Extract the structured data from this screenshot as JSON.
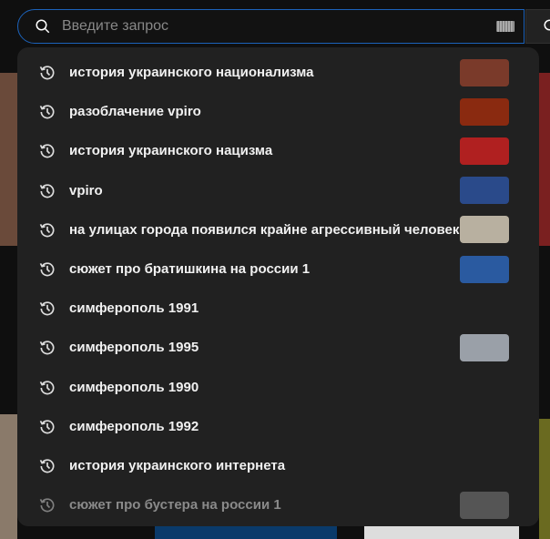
{
  "search": {
    "placeholder": "Введите запрос"
  },
  "suggestions": [
    {
      "text": "история украинского национализма",
      "thumb": "#7a3a2a",
      "dim": false
    },
    {
      "text": "разоблачение vpiro",
      "thumb": "#8a2a10",
      "dim": false
    },
    {
      "text": "история украинского нацизма",
      "thumb": "#b02020",
      "dim": false
    },
    {
      "text": "vpiro",
      "thumb": "#2a4a8a",
      "dim": false
    },
    {
      "text": "на улицах города появился крайне агрессивный человек",
      "thumb": "#b8b0a0",
      "dim": false
    },
    {
      "text": "сюжет про братишкина на россии 1",
      "thumb": "#2a5aa0",
      "dim": false
    },
    {
      "text": "симферополь 1991",
      "thumb": null,
      "dim": false
    },
    {
      "text": "симферополь 1995",
      "thumb": "#9aa0a8",
      "dim": false
    },
    {
      "text": "симферополь 1990",
      "thumb": null,
      "dim": false
    },
    {
      "text": "симферополь 1992",
      "thumb": null,
      "dim": false
    },
    {
      "text": "история украинского интернета",
      "thumb": null,
      "dim": false
    },
    {
      "text": "сюжет про бустера на россии 1",
      "thumb": "#555",
      "dim": true
    }
  ]
}
